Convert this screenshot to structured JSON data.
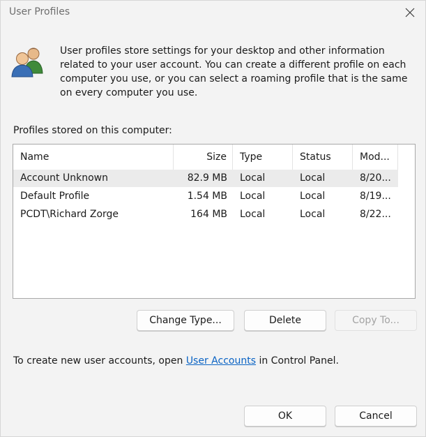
{
  "window": {
    "title": "User Profiles"
  },
  "intro": {
    "text": "User profiles store settings for your desktop and other information related to your user account. You can create a different profile on each computer you use, or you can select a roaming profile that is the same on every computer you use."
  },
  "profiles_section": {
    "label": "Profiles stored on this computer:",
    "columns": [
      "Name",
      "Size",
      "Type",
      "Status",
      "Mod..."
    ],
    "rows": [
      {
        "name": "Account Unknown",
        "size": "82.9 MB",
        "type": "Local",
        "status": "Local",
        "modified": "8/20..."
      },
      {
        "name": "Default Profile",
        "size": "1.54 MB",
        "type": "Local",
        "status": "Local",
        "modified": "8/19..."
      },
      {
        "name": "PCDT\\Richard Zorge",
        "size": "164 MB",
        "type": "Local",
        "status": "Local",
        "modified": "8/22..."
      }
    ]
  },
  "actions": {
    "change_type": "Change Type...",
    "delete": "Delete",
    "copy_to": "Copy To..."
  },
  "footer": {
    "prefix": "To create new user accounts, open ",
    "link": "User Accounts",
    "suffix": " in Control Panel."
  },
  "dialog_buttons": {
    "ok": "OK",
    "cancel": "Cancel"
  }
}
